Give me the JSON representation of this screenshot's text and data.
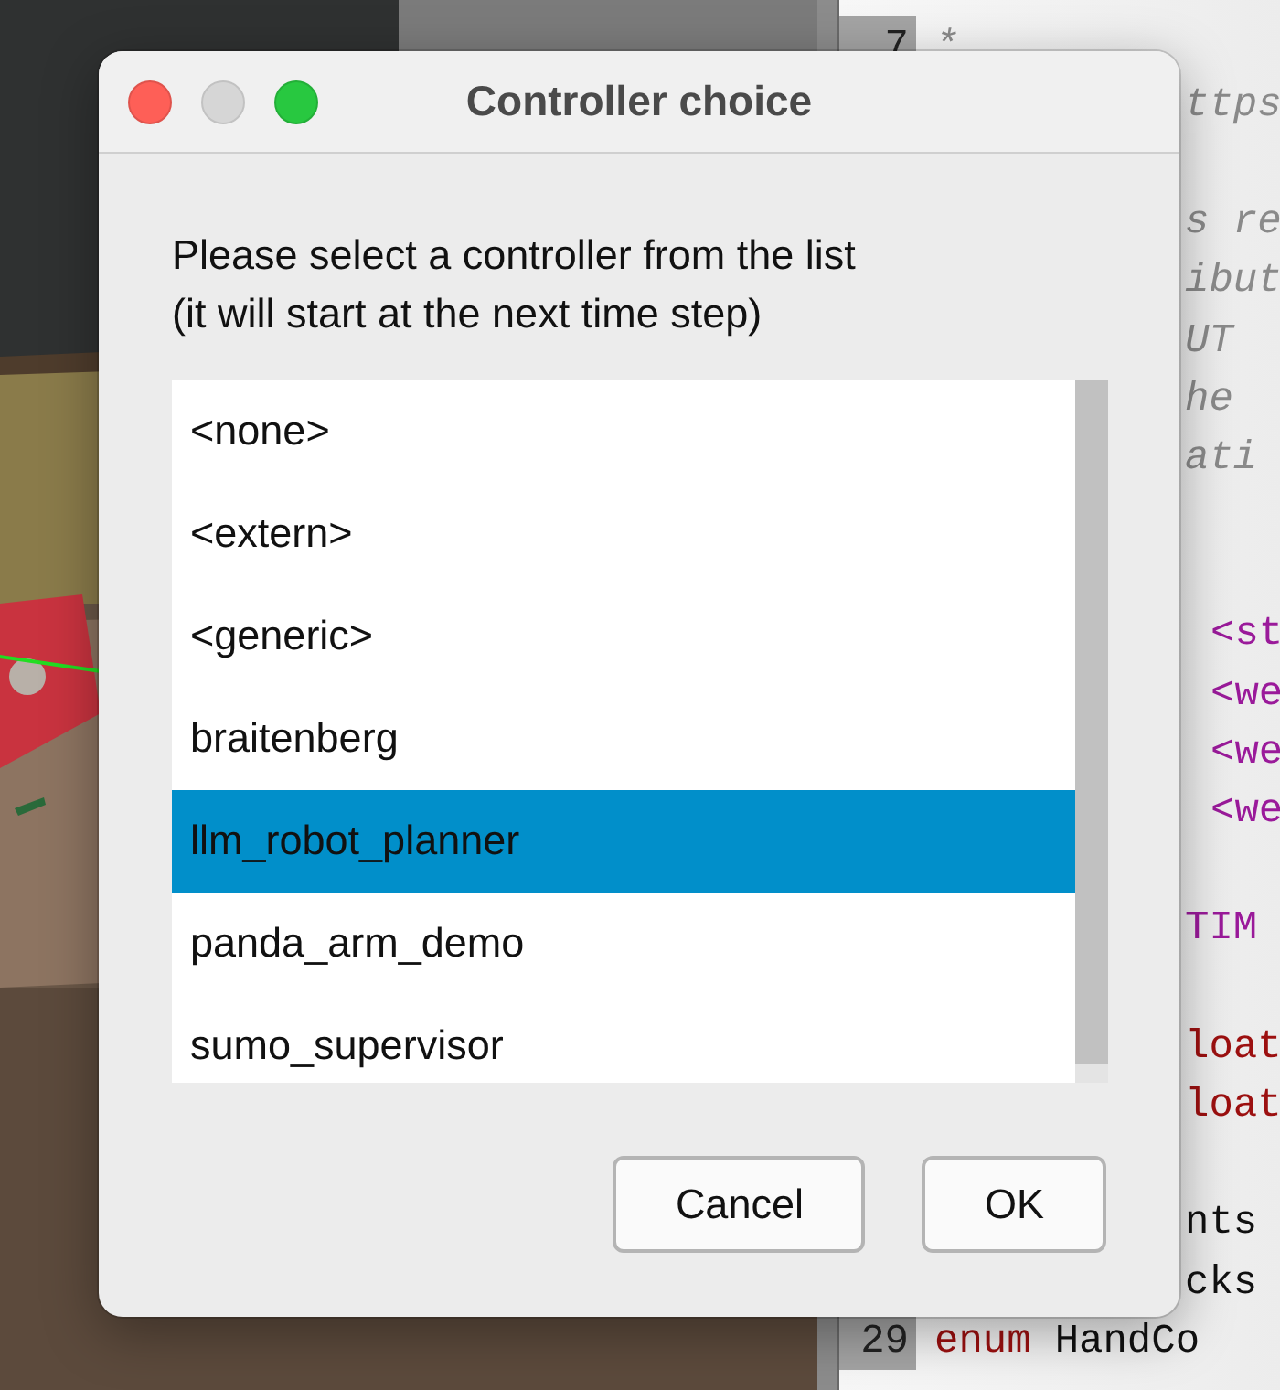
{
  "editor": {
    "lines": [
      {
        "kind": "code",
        "number": "7",
        "covered": false,
        "segments": [
          {
            "kind": "comment",
            "text": "*"
          }
        ]
      },
      {
        "kind": "code",
        "covered": true,
        "segments": [
          {
            "kind": "comment",
            "text": "ttps"
          }
        ]
      },
      {
        "kind": "blank"
      },
      {
        "kind": "code",
        "covered": true,
        "segments": [
          {
            "kind": "comment",
            "text": "s re"
          }
        ]
      },
      {
        "kind": "code",
        "covered": true,
        "segments": [
          {
            "kind": "comment",
            "text": "ibut"
          }
        ]
      },
      {
        "kind": "code",
        "covered": true,
        "segments": [
          {
            "kind": "comment",
            "text": "UT"
          }
        ]
      },
      {
        "kind": "code",
        "covered": true,
        "segments": [
          {
            "kind": "comment",
            "text": "he"
          }
        ]
      },
      {
        "kind": "code",
        "covered": true,
        "segments": [
          {
            "kind": "comment",
            "text": "ati"
          }
        ]
      },
      {
        "kind": "blank"
      },
      {
        "kind": "blank"
      },
      {
        "kind": "code",
        "covered": true,
        "segments": [
          {
            "kind": "tag",
            "text": "<st"
          }
        ]
      },
      {
        "kind": "code",
        "covered": true,
        "segments": [
          {
            "kind": "tag",
            "text": "<we"
          }
        ]
      },
      {
        "kind": "code",
        "covered": true,
        "segments": [
          {
            "kind": "tag",
            "text": "<we"
          }
        ]
      },
      {
        "kind": "code",
        "covered": true,
        "segments": [
          {
            "kind": "tag",
            "text": "<we"
          }
        ]
      },
      {
        "kind": "blank"
      },
      {
        "kind": "code",
        "covered": true,
        "segments": [
          {
            "kind": "macro",
            "text": "TIM"
          }
        ]
      },
      {
        "kind": "blank"
      },
      {
        "kind": "code",
        "covered": true,
        "segments": [
          {
            "kind": "keyword",
            "text": "loat"
          }
        ]
      },
      {
        "kind": "code",
        "covered": true,
        "segments": [
          {
            "kind": "keyword",
            "text": "loat"
          }
        ]
      },
      {
        "kind": "blank"
      },
      {
        "kind": "code",
        "covered": true,
        "segments": [
          {
            "kind": "plain",
            "text": "nts"
          }
        ]
      },
      {
        "kind": "code",
        "covered": true,
        "segments": [
          {
            "kind": "plain",
            "text": "cks"
          }
        ]
      },
      {
        "kind": "code",
        "number": "29",
        "covered": false,
        "segments": [
          {
            "kind": "keyword",
            "text": "enum"
          },
          {
            "kind": "plain",
            "text": "HandCo"
          }
        ]
      }
    ]
  },
  "dialog": {
    "title": "Controller choice",
    "window_controls": [
      {
        "kind": "close",
        "disabled": false
      },
      {
        "kind": "minimize",
        "disabled": true
      },
      {
        "kind": "zoom",
        "disabled": false
      }
    ],
    "prompt": [
      "Please select a controller from the list",
      "(it will start at the next time step)"
    ],
    "controllers": [
      {
        "label": "<none>",
        "selected": false
      },
      {
        "label": "<extern>",
        "selected": false
      },
      {
        "label": "<generic>",
        "selected": false
      },
      {
        "label": "braitenberg",
        "selected": false
      },
      {
        "label": "llm_robot_planner",
        "selected": true
      },
      {
        "label": "panda_arm_demo",
        "selected": false
      },
      {
        "label": "sumo_supervisor",
        "selected": false
      }
    ],
    "buttons": [
      "Cancel",
      "OK"
    ]
  }
}
